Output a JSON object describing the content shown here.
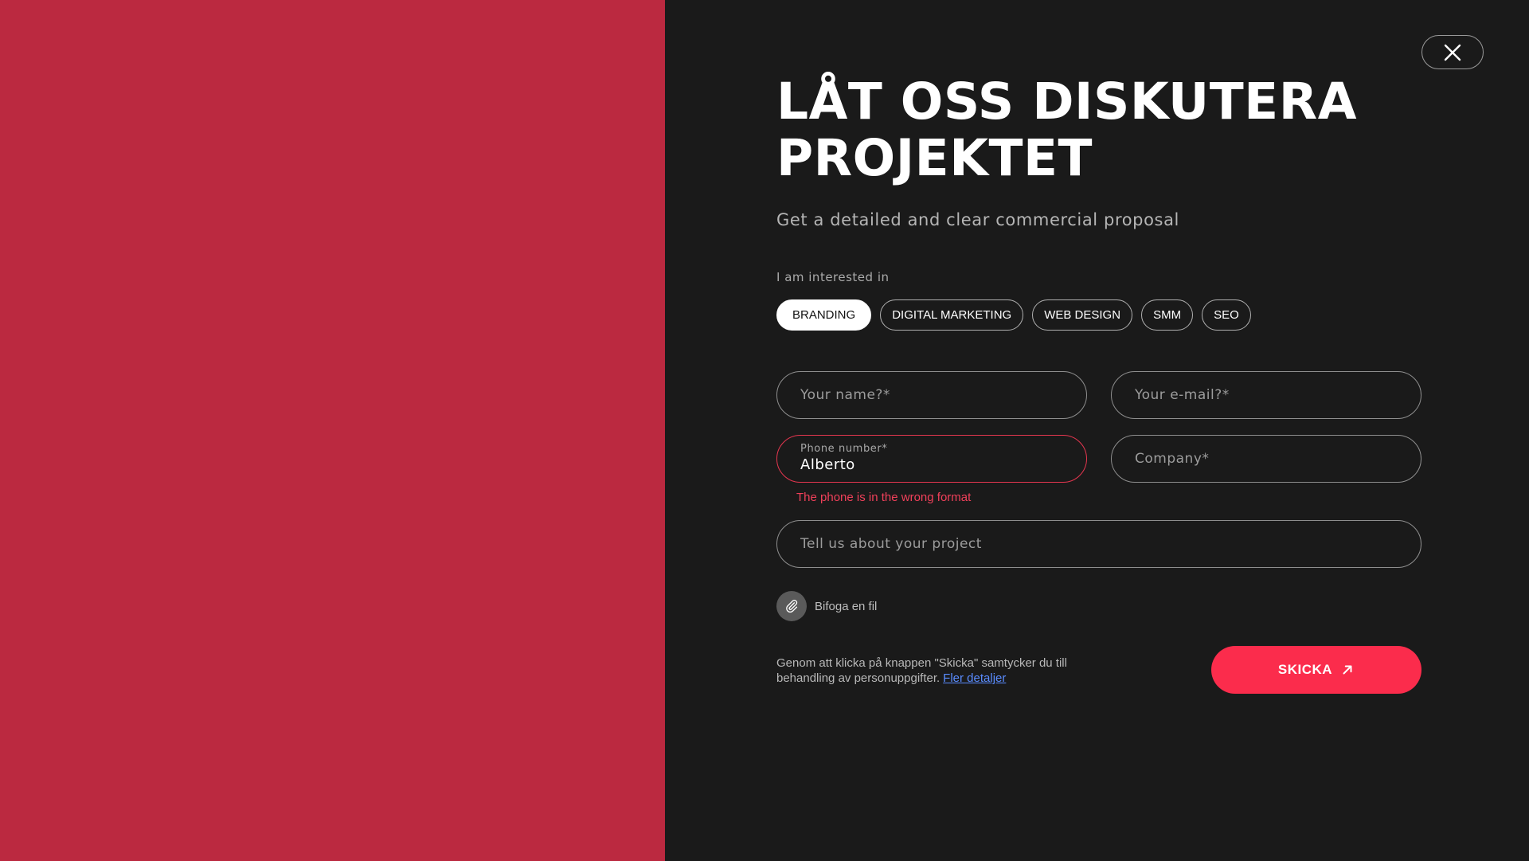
{
  "title": "LÅT OSS DISKUTERA PROJEKTET",
  "subtitle": "Get a detailed and clear commercial proposal",
  "interest": {
    "label": "I am interested in",
    "chips": [
      {
        "label": "BRANDING",
        "selected": true
      },
      {
        "label": "DIGITAL MARKETING",
        "selected": false
      },
      {
        "label": "WEB DESIGN",
        "selected": false
      },
      {
        "label": "SMM",
        "selected": false
      },
      {
        "label": "SEO",
        "selected": false
      }
    ]
  },
  "form": {
    "name_placeholder": "Your name?*",
    "email_placeholder": "Your e-mail?*",
    "phone_label": "Phone number*",
    "phone_value": "Alberto",
    "phone_error": "The phone is in the wrong format",
    "company_placeholder": "Company*",
    "project_placeholder": "Tell us about your project"
  },
  "attach": {
    "label": "Bifoga en fil",
    "icon": "paperclip-icon"
  },
  "consent": {
    "text": "Genom att klicka på knappen \"Skicka\" samtycker du till behandling av personuppgifter.",
    "link": "Fler detaljer"
  },
  "submit": {
    "label": "SKICKA",
    "icon": "arrow-up-right-icon"
  },
  "close": {
    "icon": "close-icon"
  },
  "colors": {
    "left_panel": "#bb2940",
    "background": "#1a1a1a",
    "accent": "#fb2c4c",
    "error": "#e5364f",
    "link": "#5a8cff"
  }
}
